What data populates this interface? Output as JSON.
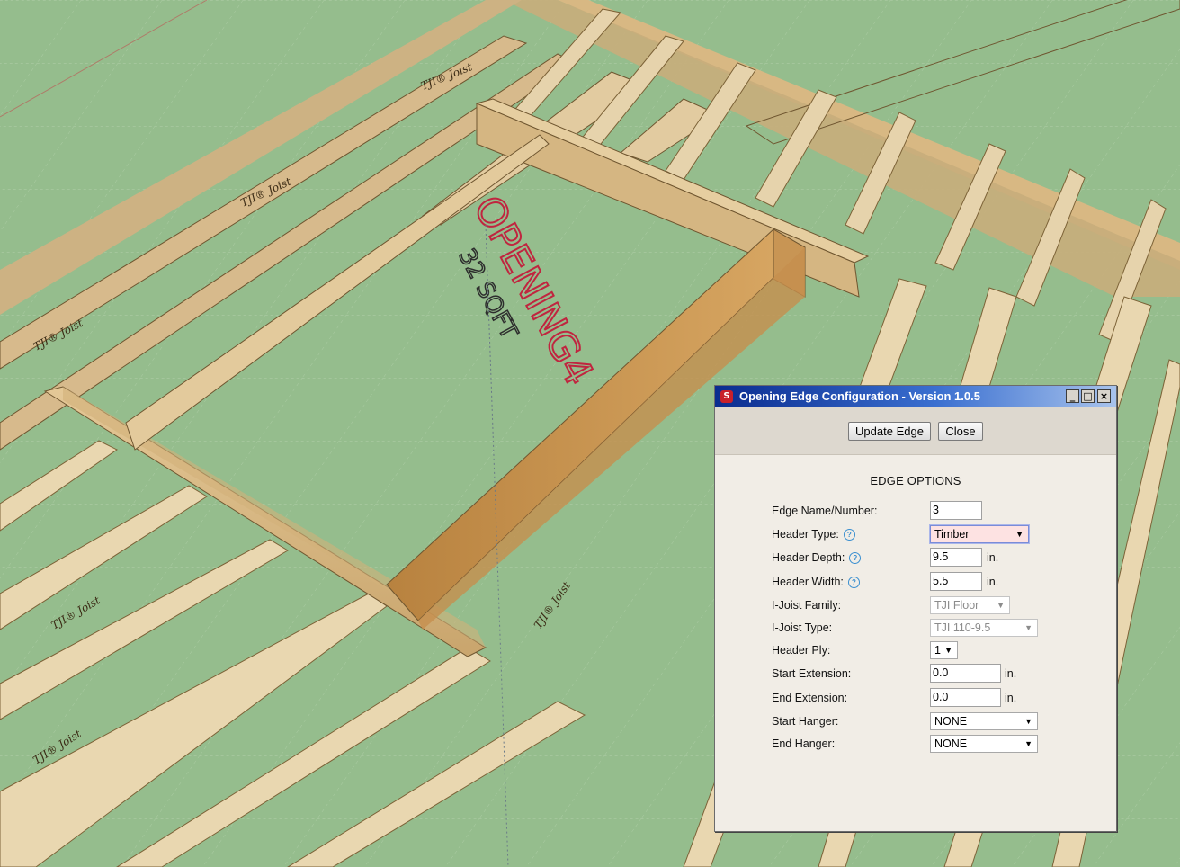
{
  "scene": {
    "opening_label": "OPENING4",
    "area_label": "32 SQFT",
    "joist_brand": "TJI® Joist",
    "colors": {
      "ground": "#95bd8d",
      "wood": "#d6b889",
      "label": "#c0253f"
    }
  },
  "dialog": {
    "title": "Opening Edge Configuration - Version 1.0.5",
    "window_controls": {
      "minimize": "_",
      "maximize": "□",
      "close": "×"
    },
    "buttons": {
      "update": "Update Edge",
      "close": "Close"
    },
    "section_title": "EDGE OPTIONS",
    "fields": {
      "edge_name": {
        "label": "Edge Name/Number:",
        "value": "3"
      },
      "header_type": {
        "label": "Header Type:",
        "value": "Timber"
      },
      "header_depth": {
        "label": "Header Depth:",
        "value": "9.5",
        "unit": "in."
      },
      "header_width": {
        "label": "Header Width:",
        "value": "5.5",
        "unit": "in."
      },
      "ijoist_family": {
        "label": "I-Joist Family:",
        "value": "TJI Floor"
      },
      "ijoist_type": {
        "label": "I-Joist Type:",
        "value": "TJI 110-9.5"
      },
      "header_ply": {
        "label": "Header Ply:",
        "value": "1"
      },
      "start_extension": {
        "label": "Start Extension:",
        "value": "0.0",
        "unit": "in."
      },
      "end_extension": {
        "label": "End Extension:",
        "value": "0.0",
        "unit": "in."
      },
      "start_hanger": {
        "label": "Start Hanger:",
        "value": "NONE"
      },
      "end_hanger": {
        "label": "End Hanger:",
        "value": "NONE"
      }
    }
  }
}
